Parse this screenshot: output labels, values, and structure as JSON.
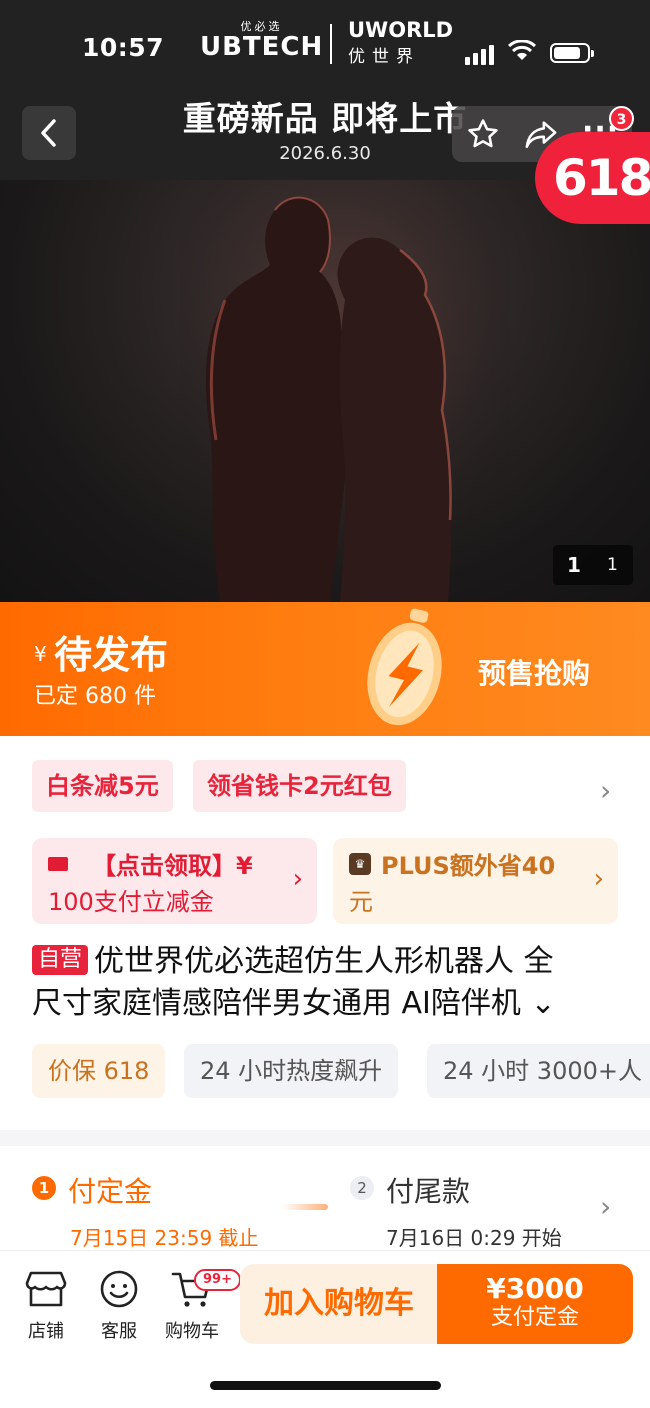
{
  "status_bar": {
    "time": "10:57"
  },
  "brand": {
    "ubtech_small": "优必选",
    "ubtech": "UBTECH",
    "uworld": "UWORLD",
    "uworld_cn": "优世界"
  },
  "hero": {
    "title": "重磅新品 即将上市",
    "date": "2026.6.30",
    "notification_count": "3",
    "promo_badge": "618",
    "page_current": "1",
    "page_total": "1"
  },
  "price": {
    "currency": "¥",
    "status": "待发布",
    "sold": "已定 680 件",
    "presale": "预售抢购"
  },
  "coupons": [
    "白条减5元",
    "领省钱卡2元红包"
  ],
  "promo_cards": {
    "red_line1": "【点击领取】¥",
    "red_line2": "100支付立减金",
    "gold_line1": "PLUS额外省40",
    "gold_line2": "元"
  },
  "product": {
    "self_operated": "自营",
    "title_line1": "优世界优必选超仿生人形机器人 全",
    "title_line2": "尺寸家庭情感陪伴男女通用 AI陪伴机 ⌄"
  },
  "tags": [
    "价保 618",
    "24 小时热度飙升",
    "24 小时 3000+人"
  ],
  "deposit": {
    "step1_num": "1",
    "step1_label": "付定金",
    "step1_date": "7月15日 23:59 截止",
    "step2_num": "2",
    "step2_label": "付尾款",
    "step2_date": "7月16日 0:29 开始"
  },
  "bottom_bar": {
    "store": "店铺",
    "service": "客服",
    "cart": "购物车",
    "cart_badge": "99+",
    "add_to_cart": "加入购物车",
    "pay_amount": "¥3000",
    "pay_label": "支付定金"
  },
  "colors": {
    "accent_orange": "#ff6a00",
    "promo_red": "#f0213a",
    "coupon_red": "#e8243c"
  }
}
